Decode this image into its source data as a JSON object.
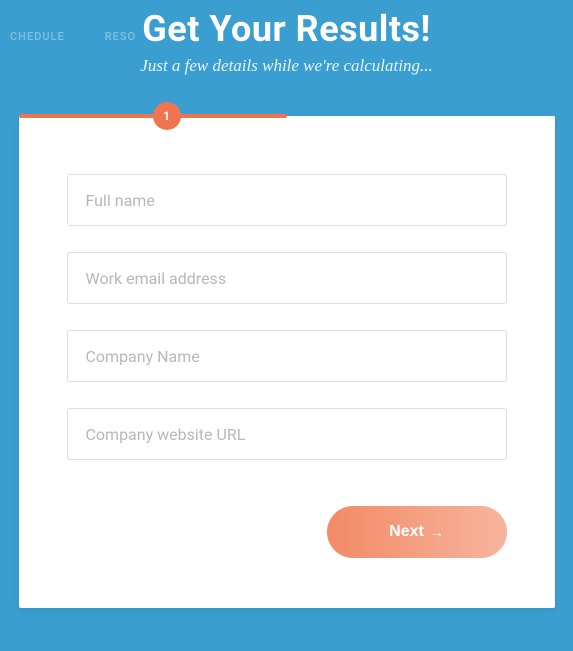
{
  "background_nav": [
    "CHEDULE",
    "RESO"
  ],
  "header": {
    "title": "Get Your Results!",
    "subtitle": "Just a few details while we're calculating..."
  },
  "progress": {
    "current_step": "1"
  },
  "form": {
    "fields": [
      {
        "placeholder": "Full name"
      },
      {
        "placeholder": "Work email address"
      },
      {
        "placeholder": "Company Name"
      },
      {
        "placeholder": "Company website URL"
      }
    ]
  },
  "actions": {
    "next_label": "Next",
    "arrow": "→"
  },
  "colors": {
    "background": "#3a9fd0",
    "accent": "#f0744f"
  }
}
